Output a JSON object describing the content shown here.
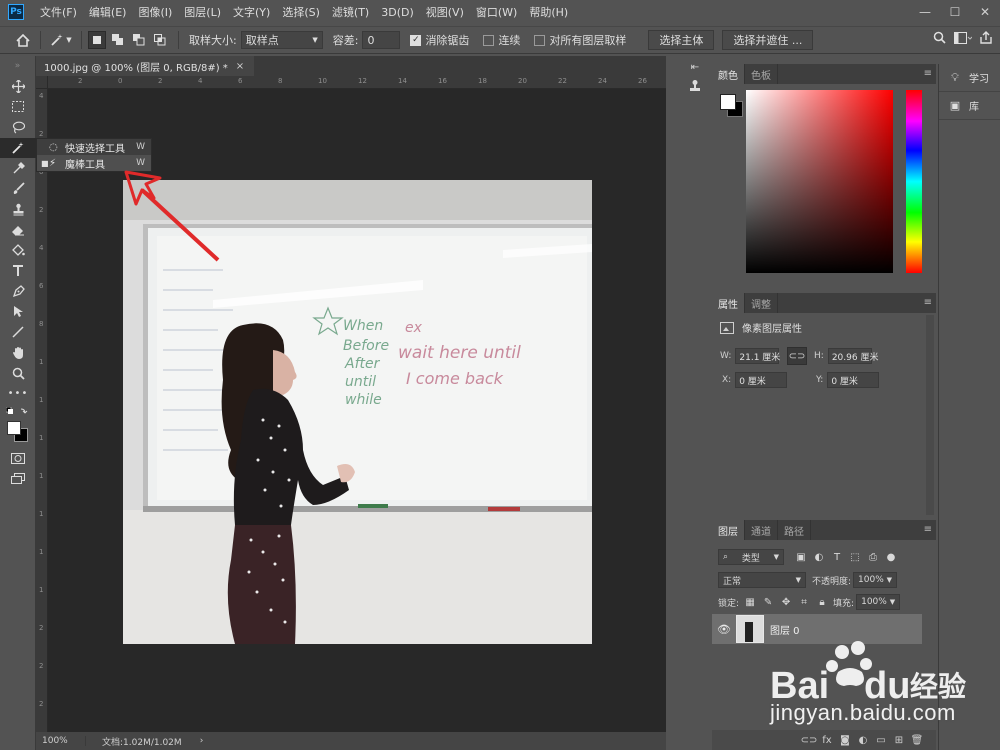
{
  "menu": {
    "logo": "Ps",
    "items": [
      "文件(F)",
      "编辑(E)",
      "图像(I)",
      "图层(L)",
      "文字(Y)",
      "选择(S)",
      "滤镜(T)",
      "3D(D)",
      "视图(V)",
      "窗口(W)",
      "帮助(H)"
    ],
    "window_controls": {
      "minimize": "—",
      "maximize": "☐",
      "close": "✕"
    }
  },
  "options": {
    "sample_size_label": "取样大小:",
    "sample_size_value": "取样点",
    "tolerance_label": "容差:",
    "tolerance_value": "0",
    "antialias_label": "消除锯齿",
    "antialias_checked": true,
    "contiguous_label": "连续",
    "contiguous_checked": false,
    "all_layers_label": "对所有图层取样",
    "all_layers_checked": false,
    "select_subject": "选择主体",
    "select_mask": "选择并遮住 ..."
  },
  "document": {
    "tab_title": "1000.jpg @ 100% (图层 0, RGB/8#) *",
    "tab_close": "×",
    "ruler_h_labels": [
      "2",
      "0",
      "2",
      "4",
      "6",
      "8",
      "10",
      "12",
      "14",
      "16",
      "18",
      "20",
      "22",
      "24",
      "26"
    ],
    "ruler_v_labels": [
      "4",
      "2",
      "0",
      "2",
      "4",
      "6",
      "8",
      "1",
      "1",
      "1",
      "1",
      "1",
      "1",
      "1",
      "2",
      "2",
      "2"
    ],
    "whiteboard_text": {
      "col1": [
        "When",
        "Before",
        "After",
        "until",
        "while"
      ],
      "ex": "ex",
      "line1": "wait here until",
      "line2": "I come back"
    }
  },
  "flyout": {
    "items": [
      {
        "label": "快速选择工具",
        "key": "W",
        "selected": false
      },
      {
        "label": "魔棒工具",
        "key": "W",
        "selected": true
      }
    ]
  },
  "status": {
    "zoom": "100%",
    "doc": "文档:1.02M/1.02M",
    "arrow": "›"
  },
  "color_panel": {
    "tabs": [
      "颜色",
      "色板"
    ],
    "fg": "#ffffff",
    "bg": "#000000"
  },
  "props_panel": {
    "tabs": [
      "属性",
      "调整"
    ],
    "title": "像素图层属性",
    "w_label": "W:",
    "w_value": "21.1 厘米",
    "h_label": "H:",
    "h_value": "20.96 厘米",
    "x_label": "X:",
    "x_value": "0 厘米",
    "y_label": "Y:",
    "y_value": "0 厘米"
  },
  "layers_panel": {
    "tabs": [
      "图层",
      "通道",
      "路径"
    ],
    "filter_label": "类型",
    "blend_mode": "正常",
    "opacity_label": "不透明度:",
    "opacity_value": "100%",
    "lock_label": "锁定:",
    "fill_label": "填充:",
    "fill_value": "100%",
    "layer_name": "图层 0"
  },
  "learn_col": {
    "items": [
      "学习",
      "库"
    ]
  },
  "watermark": {
    "url": "jingyan.baidu.com"
  },
  "icons": {
    "tools": [
      "move-icon",
      "marquee-icon",
      "lasso-icon",
      "magic-wand-icon",
      "eyedropper-icon",
      "brush-icon",
      "stamp-icon",
      "eraser-icon",
      "paint-bucket-icon",
      "type-icon",
      "pen-icon",
      "path-select-icon",
      "line-icon",
      "hand-icon",
      "zoom-icon",
      "more-icon"
    ]
  }
}
